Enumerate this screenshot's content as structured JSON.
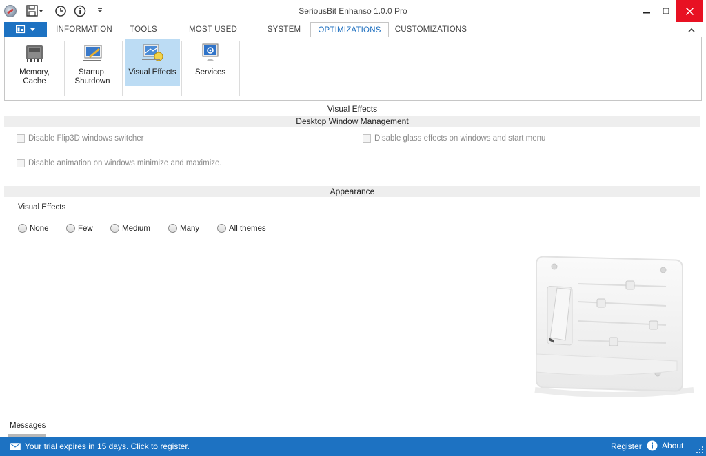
{
  "window": {
    "title": "SeriousBit Enhanso 1.0.0 Pro",
    "icons": [
      "app-icon",
      "save-icon",
      "history-icon",
      "info-icon",
      "customize-arrow-icon",
      "minimize-icon",
      "maximize-icon",
      "close-icon"
    ]
  },
  "tabs": [
    {
      "label": "INFORMATION",
      "active": false
    },
    {
      "label": "TOOLS",
      "active": false
    },
    {
      "label": "MOST USED TWEAKS",
      "active": false
    },
    {
      "label": "SYSTEM",
      "active": false
    },
    {
      "label": "OPTIMIZATIONS",
      "active": true
    },
    {
      "label": "CUSTOMIZATIONS",
      "active": false
    }
  ],
  "ribbon": {
    "buttons": [
      {
        "label": "Memory,\nCache",
        "icon": "memory-chip-icon",
        "active": false
      },
      {
        "label": "Startup,\nShutdown",
        "icon": "startup-icon",
        "active": false
      },
      {
        "label": "Visual Effects",
        "icon": "visual-effects-icon",
        "active": true
      },
      {
        "label": "Services",
        "icon": "services-icon",
        "active": false
      }
    ]
  },
  "page": {
    "title": "Visual Effects",
    "section_dwm": "Desktop Window Management",
    "section_appearance": "Appearance"
  },
  "dwm_options": [
    {
      "label": "Disable Flip3D windows switcher",
      "checked": false,
      "enabled": false
    },
    {
      "label": "Disable glass effects on windows and start menu",
      "checked": false,
      "enabled": false
    },
    {
      "label": "Disable animation on windows minimize and maximize.",
      "checked": false,
      "enabled": false
    }
  ],
  "appearance": {
    "group_label": "Visual Effects",
    "options": [
      "None",
      "Few",
      "Medium",
      "Many",
      "All themes"
    ]
  },
  "messages": {
    "label": "Messages"
  },
  "status": {
    "trial_text": "Your trial expires in 15 days. Click to register.",
    "register": "Register",
    "about": "About"
  },
  "colors": {
    "accent": "#1d72c2",
    "ribbon_active": "#bcdcf4",
    "close": "#e81123"
  }
}
